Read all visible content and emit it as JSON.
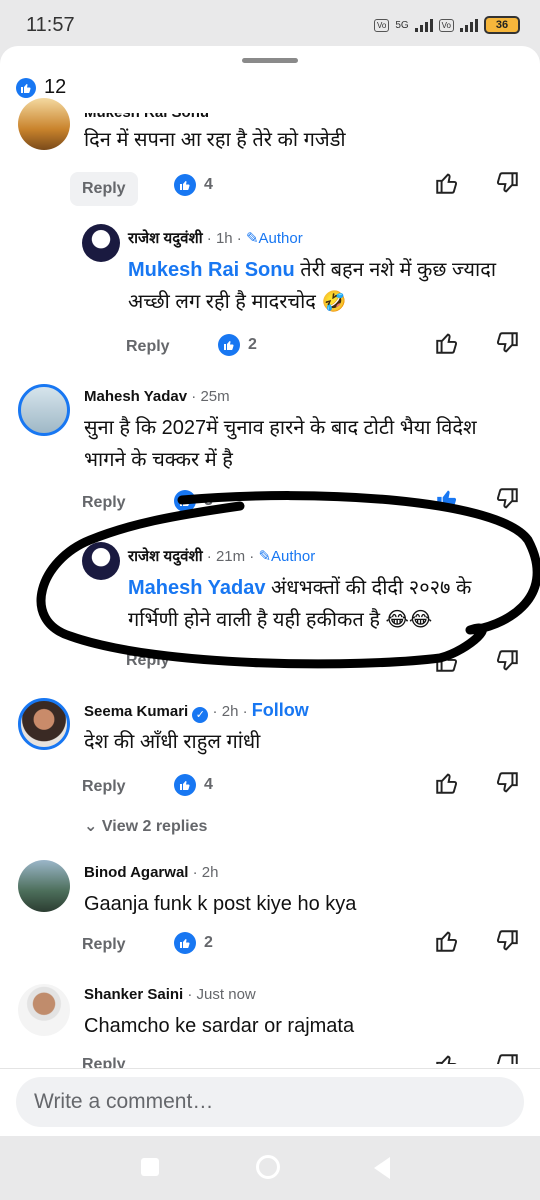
{
  "status_bar": {
    "time": "11:57",
    "network": "5G",
    "battery": "36"
  },
  "header": {
    "like_count": "12"
  },
  "comments": [
    {
      "name": "Mukesh Rai Sonu",
      "text": "दिन में सपना आ रहा है तेरे को  गजेडी",
      "reply_label": "Reply",
      "likes": "4"
    },
    {
      "name": "राजेश यदुवंशी",
      "time": " · 1h · ",
      "author_label": "Author",
      "mention": "Mukesh Rai Sonu",
      "text_line1": " तेरी बहन नशे में कुछ ज्यादा",
      "text_line2": "अच्छी लग रही है मादरचोद 🤣",
      "reply_label": "Reply",
      "likes": "2"
    },
    {
      "name": "Mahesh Yadav",
      "time": " · 25m",
      "text_line1": "सुना है कि 2027में चुनाव हारने के बाद टोटी भैया विदेश",
      "text_line2": "भागने के चक्कर में है",
      "reply_label": "Reply",
      "likes": "3"
    },
    {
      "name": "राजेश यदुवंशी",
      "time": " · 21m · ",
      "author_label": "Author",
      "mention": "Mahesh Yadav",
      "text_line1": " अंधभक्तों की दीदी २०२७ के",
      "text_line2": "गर्भिणी होने वाली है यही हकीकत है 😂😂",
      "reply_label": "Reply"
    },
    {
      "name": "Seema Kumari",
      "time": " · 2h · ",
      "follow_label": "Follow",
      "text": "देश की आँधी  राहुल गांधी",
      "reply_label": "Reply",
      "likes": "4",
      "view_replies": "View 2 replies"
    },
    {
      "name": "Binod Agarwal",
      "time": " · 2h",
      "text": "Gaanja funk k post kiye ho kya",
      "reply_label": "Reply",
      "likes": "2"
    },
    {
      "name": "Shanker Saini",
      "time": " · Just now",
      "text": "Chamcho ke sardar or rajmata",
      "reply_label": "Reply"
    }
  ],
  "composer": {
    "placeholder": "Write a comment…"
  },
  "colors": {
    "accent": "#1877f2",
    "meta_gray": "#65676b"
  }
}
